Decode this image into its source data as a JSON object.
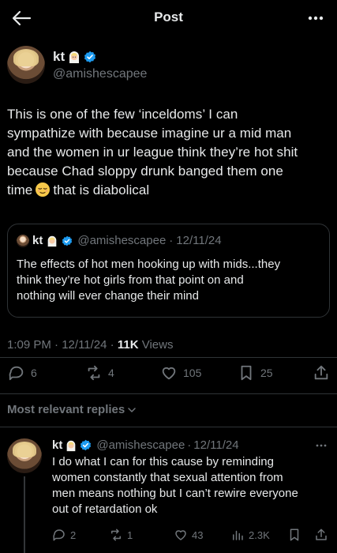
{
  "header": {
    "title": "Post",
    "back_icon": "arrow-left-icon",
    "more_icon": "more-horizontal-icon"
  },
  "author": {
    "name": "kt",
    "name_emoji": "woman-with-veil-emoji",
    "handle": "@amishescapee",
    "verified": true
  },
  "tweet": {
    "text_lines": [
      "This is one of the few ‘inceldoms’ I can",
      "sympathize with because imagine ur a mid man",
      "and the women in ur league think they’re hot shit",
      "because Chad sloppy drunk banged them one",
      "time",
      "that is diabolical"
    ],
    "inline_emoji": "relieved-face-emoji"
  },
  "quote": {
    "name": "kt",
    "handle": "@amishescapee",
    "separator": "·",
    "date": "12/11/24",
    "text_lines": [
      "The effects of hot men hooking up with mids...they",
      "think they’re hot girls from that point on and",
      "nothing will ever change their mind"
    ]
  },
  "meta": {
    "time": "1:09 PM",
    "sep1": "·",
    "date": "12/11/24",
    "sep2": "·",
    "views_count": "11K",
    "views_label": "Views"
  },
  "actions": {
    "replies": "6",
    "reposts": "4",
    "likes": "105",
    "bookmarks": "25"
  },
  "replies_sort": {
    "label": "Most relevant replies"
  },
  "reply": {
    "name": "kt",
    "handle": "@amishescapee",
    "separator": "·",
    "date": "12/11/24",
    "text_lines": [
      "I do what I can for this cause by reminding",
      "women constantly that sexual attention from",
      "men means nothing but I can’t rewire everyone",
      "out of retardation ok"
    ],
    "stats": {
      "replies": "2",
      "reposts": "1",
      "likes": "43",
      "views": "2.3K"
    }
  },
  "colors": {
    "background": "#000000",
    "text": "#e7e9ea",
    "secondary": "#71767b",
    "border": "#2f3336",
    "verified_blue": "#1d9bf0"
  }
}
